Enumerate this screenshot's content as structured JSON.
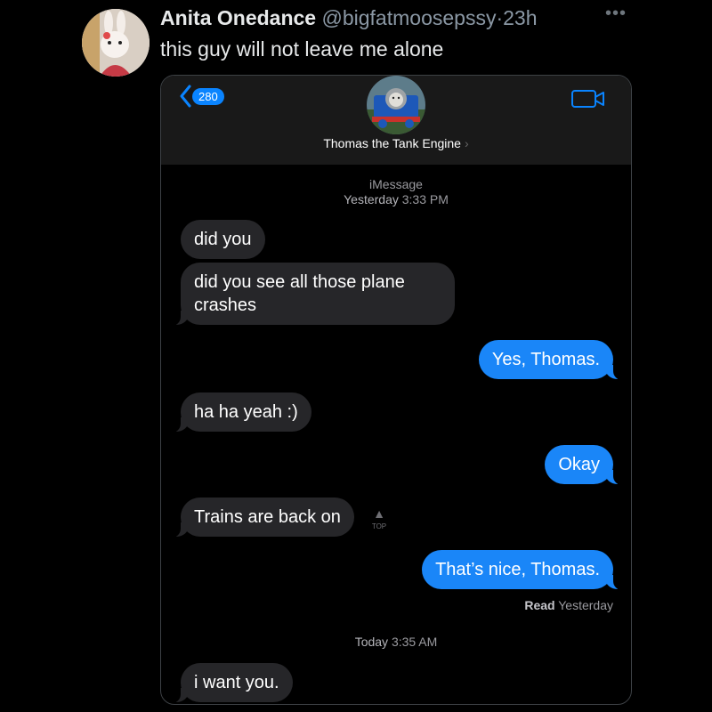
{
  "tweet": {
    "display_name": "Anita Onedance",
    "handle": "@bigfatmoosepssy",
    "separator": "·",
    "time": "23h",
    "text": "this guy will not leave me alone",
    "more_icon": "more-horizontal-icon"
  },
  "imessage": {
    "back_count": "280",
    "contact_name": "Thomas the Tank Engine",
    "contact_chevron": "›",
    "service": "iMessage",
    "yesterday_label": "Yesterday",
    "yesterday_time": "3:33 PM",
    "today_label": "Today",
    "today_time": "3:35 AM",
    "read_label": "Read",
    "read_time": "Yesterday",
    "top_label": "TOP",
    "messages": [
      {
        "from": "them",
        "text": "did you"
      },
      {
        "from": "them",
        "text": "did you see all those plane crashes"
      },
      {
        "from": "me",
        "text": "Yes, Thomas."
      },
      {
        "from": "them",
        "text": "ha ha yeah :)"
      },
      {
        "from": "me",
        "text": "Okay"
      },
      {
        "from": "them",
        "text": "Trains are back on"
      },
      {
        "from": "me",
        "text": "That’s nice, Thomas."
      },
      {
        "from": "them",
        "text": "i want you."
      }
    ],
    "colors": {
      "incoming_bubble": "#262629",
      "outgoing_bubble": "#1a86f8",
      "accent": "#0a84ff"
    }
  }
}
